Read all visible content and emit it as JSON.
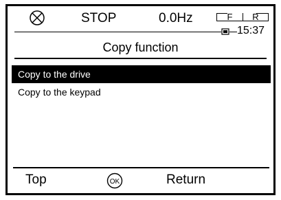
{
  "status": {
    "drive_state": "STOP",
    "frequency": "0.0Hz",
    "fr_labels": [
      "F",
      "R"
    ],
    "time": "15:37",
    "state_icon": "stop-circle-cross-icon",
    "battery_icon": "battery-icon"
  },
  "screen": {
    "title": "Copy function"
  },
  "menu": {
    "selected_index": 0,
    "items": [
      {
        "label": "Copy to the drive"
      },
      {
        "label": "Copy to the keypad"
      }
    ]
  },
  "softkeys": {
    "left": "Top",
    "center_icon": "ok-icon",
    "center": "OK",
    "right": "Return"
  },
  "colors": {
    "foreground": "#000000",
    "background": "#ffffff",
    "selection_bg": "#000000",
    "selection_fg": "#ffffff"
  }
}
